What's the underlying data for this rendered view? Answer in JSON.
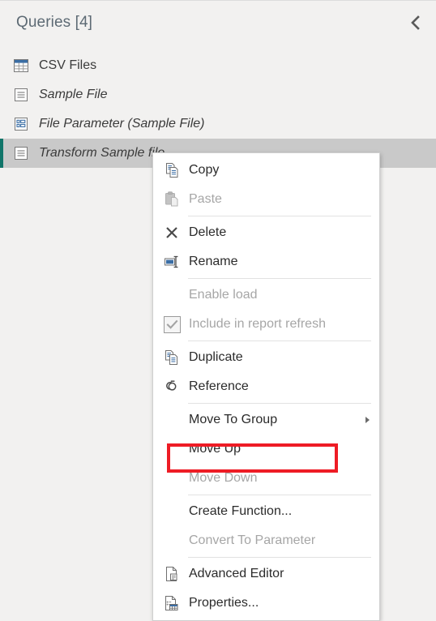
{
  "pane": {
    "title": "Queries [4]",
    "collapse_icon": "chevron-left-icon"
  },
  "queries": [
    {
      "label": "CSV Files",
      "icon": "table-icon",
      "italic": false,
      "selected": false
    },
    {
      "label": "Sample File",
      "icon": "document-lines-icon",
      "italic": true,
      "selected": false
    },
    {
      "label": "File Parameter (Sample File)",
      "icon": "parameter-list-icon",
      "italic": true,
      "selected": false
    },
    {
      "label": "Transform Sample file",
      "icon": "document-lines-icon",
      "italic": true,
      "selected": true
    }
  ],
  "context_menu": {
    "items": [
      {
        "label": "Copy",
        "icon": "copy-icon",
        "disabled": false,
        "separator_after": false,
        "submenu": false
      },
      {
        "label": "Paste",
        "icon": "paste-icon",
        "disabled": true,
        "separator_after": true,
        "submenu": false
      },
      {
        "label": "Delete",
        "icon": "delete-x-icon",
        "disabled": false,
        "separator_after": false,
        "submenu": false
      },
      {
        "label": "Rename",
        "icon": "rename-icon",
        "disabled": false,
        "separator_after": true,
        "submenu": false
      },
      {
        "label": "Enable load",
        "icon": "none",
        "disabled": true,
        "separator_after": false,
        "submenu": false
      },
      {
        "label": "Include in report refresh",
        "icon": "checkbox-checked-icon",
        "disabled": true,
        "separator_after": true,
        "submenu": false
      },
      {
        "label": "Duplicate",
        "icon": "duplicate-icon",
        "disabled": false,
        "separator_after": false,
        "submenu": false
      },
      {
        "label": "Reference",
        "icon": "reference-link-icon",
        "disabled": false,
        "separator_after": true,
        "submenu": false
      },
      {
        "label": "Move To Group",
        "icon": "none",
        "disabled": false,
        "separator_after": false,
        "submenu": true
      },
      {
        "label": "Move Up",
        "icon": "none",
        "disabled": false,
        "separator_after": false,
        "submenu": false
      },
      {
        "label": "Move Down",
        "icon": "none",
        "disabled": true,
        "separator_after": true,
        "submenu": false
      },
      {
        "label": "Create Function...",
        "icon": "none",
        "disabled": false,
        "separator_after": false,
        "submenu": false
      },
      {
        "label": "Convert To Parameter",
        "icon": "none",
        "disabled": true,
        "separator_after": true,
        "submenu": false
      },
      {
        "label": "Advanced Editor",
        "icon": "advanced-editor-icon",
        "disabled": false,
        "separator_after": false,
        "submenu": false
      },
      {
        "label": "Properties...",
        "icon": "properties-icon",
        "disabled": false,
        "separator_after": false,
        "submenu": false
      }
    ]
  },
  "annotation": {
    "highlighted_item": "Create Function...",
    "color": "#ee1c25"
  },
  "colors": {
    "pane_background": "#f2f1f0",
    "selected_row": "#c9c9c9",
    "selection_accent": "#107569",
    "menu_background": "#ffffff",
    "title_text": "#5d6a74",
    "disabled_text": "#a6a6a6",
    "icon_blue": "#3b6ea5"
  }
}
